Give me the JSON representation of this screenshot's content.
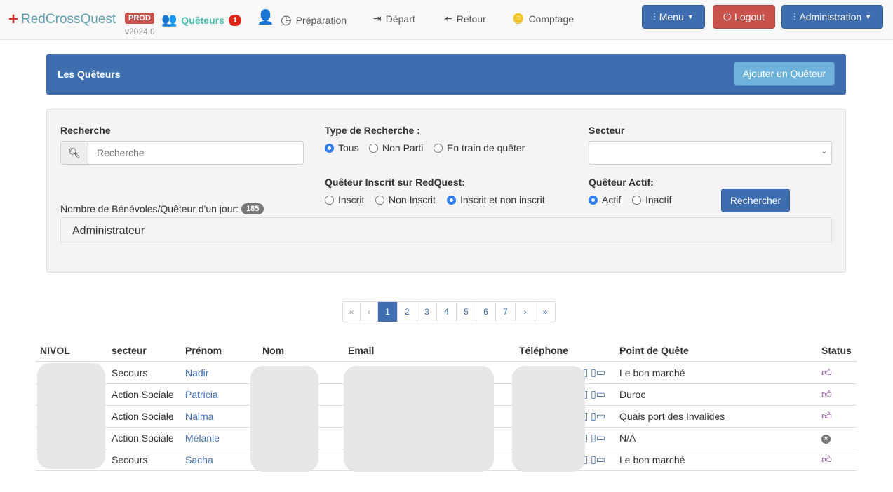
{
  "nav": {
    "brand": "RedCrossQuest",
    "env": "PROD",
    "version": "v2024.0",
    "items": [
      {
        "label": "Quêteurs",
        "badge": "1"
      },
      {
        "label": ""
      },
      {
        "label": "Préparation"
      },
      {
        "label": "Départ"
      },
      {
        "label": "Retour"
      },
      {
        "label": "Comptage"
      }
    ],
    "menu": "Menu",
    "logout": "Logout",
    "admin": "Administration"
  },
  "panel": {
    "title": "Les Quêteurs",
    "add": "Ajouter un Quêteur"
  },
  "filters": {
    "search_label": "Recherche",
    "search_placeholder": "Recherche",
    "type_label": "Type de Recherche :",
    "type_options": [
      "Tous",
      "Non Parti",
      "En train de quêter"
    ],
    "type_selected": "Tous",
    "secteur_label": "Secteur",
    "secteur_value": "",
    "inscrit_label": "Quêteur Inscrit sur RedQuest:",
    "inscrit_options": [
      "Inscrit",
      "Non Inscrit",
      "Inscrit et non inscrit"
    ],
    "inscrit_selected": "Inscrit et non inscrit",
    "actif_label": "Quêteur Actif:",
    "actif_options": [
      "Actif",
      "Inactif"
    ],
    "actif_selected": "Actif",
    "submit": "Rechercher",
    "count_label": "Nombre de Bénévoles/Quêteur d'un jour:",
    "count": "185",
    "role": "Administrateur"
  },
  "pagination": {
    "first": "«",
    "prev": "‹",
    "pages": [
      "1",
      "2",
      "3",
      "4",
      "5",
      "6",
      "7"
    ],
    "current": "1",
    "next": "›",
    "last": "»"
  },
  "table": {
    "headers": [
      "NIVOL",
      "secteur",
      "Prénom",
      "Nom",
      "Email",
      "Téléphone",
      "Point de Quête",
      "Status"
    ],
    "rows": [
      {
        "secteur": "Secours",
        "prenom": "Nadir",
        "point": "Le bon marché",
        "status": "active"
      },
      {
        "secteur": "Action Sociale",
        "prenom": "Patricia",
        "point": "Duroc",
        "status": "active"
      },
      {
        "secteur": "Action Sociale",
        "prenom": "Naima",
        "point": "Quais port des Invalides",
        "status": "active"
      },
      {
        "secteur": "Action Sociale",
        "prenom": "Mélanie",
        "point": "N/A",
        "status": "inactive"
      },
      {
        "secteur": "Secours",
        "prenom": "Sacha",
        "point": "Le bon marché",
        "status": "active"
      }
    ]
  },
  "colors": {
    "primary": "#3e6db0",
    "danger": "#c9524c",
    "accent": "#4fc1b0",
    "status_active": "#7b2a8b"
  }
}
